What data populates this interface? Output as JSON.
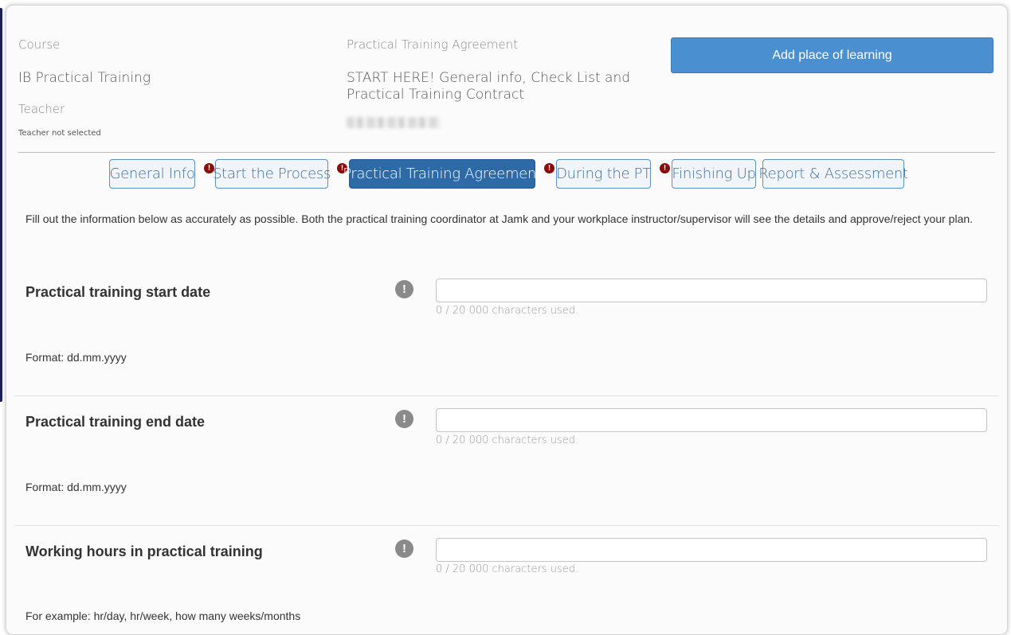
{
  "header": {
    "course_label": "Course",
    "course_value": "IB Practical Training",
    "teacher_label": "Teacher",
    "teacher_value": "Teacher not selected",
    "agreement_label": "Practical Training Agreement",
    "agreement_value": "START HERE! General info, Check List and Practical Training Contract",
    "add_button": "Add place of learning"
  },
  "tabs": [
    {
      "label": "General Info",
      "active": false,
      "warning": false
    },
    {
      "label": "Start the Process",
      "active": false,
      "warning": true
    },
    {
      "label": "Practical Training Agreement",
      "active": true,
      "warning": true
    },
    {
      "label": "During the PT",
      "active": false,
      "warning": true
    },
    {
      "label": "Finishing Up",
      "active": false,
      "warning": true
    },
    {
      "label": "Report & Assessment",
      "active": false,
      "warning": false
    }
  ],
  "intro_text": "Fill out the information below as accurately as possible. Both the practical training coordinator at Jamk and your workplace instructor/supervisor will see the details and approve/reject your plan.",
  "fields": [
    {
      "title": "Practical training start date",
      "value": "",
      "counter": "0 / 20 000 characters used.",
      "hint": "Format: dd.mm.yyyy"
    },
    {
      "title": "Practical training end date",
      "value": "",
      "counter": "0 / 20 000 characters used.",
      "hint": "Format: dd.mm.yyyy"
    },
    {
      "title": "Working hours in practical training",
      "value": "",
      "counter": "0 / 20 000 characters used.",
      "hint": "For example: hr/day, hr/week, how many weeks/months"
    }
  ],
  "colors": {
    "accent": "#4a8fd0",
    "tab_active": "#2d6aa6",
    "warning": "#8b0b0b"
  },
  "icons": {
    "tab_warning": "exclamation-circle-icon",
    "field_info": "exclamation-circle-icon"
  }
}
